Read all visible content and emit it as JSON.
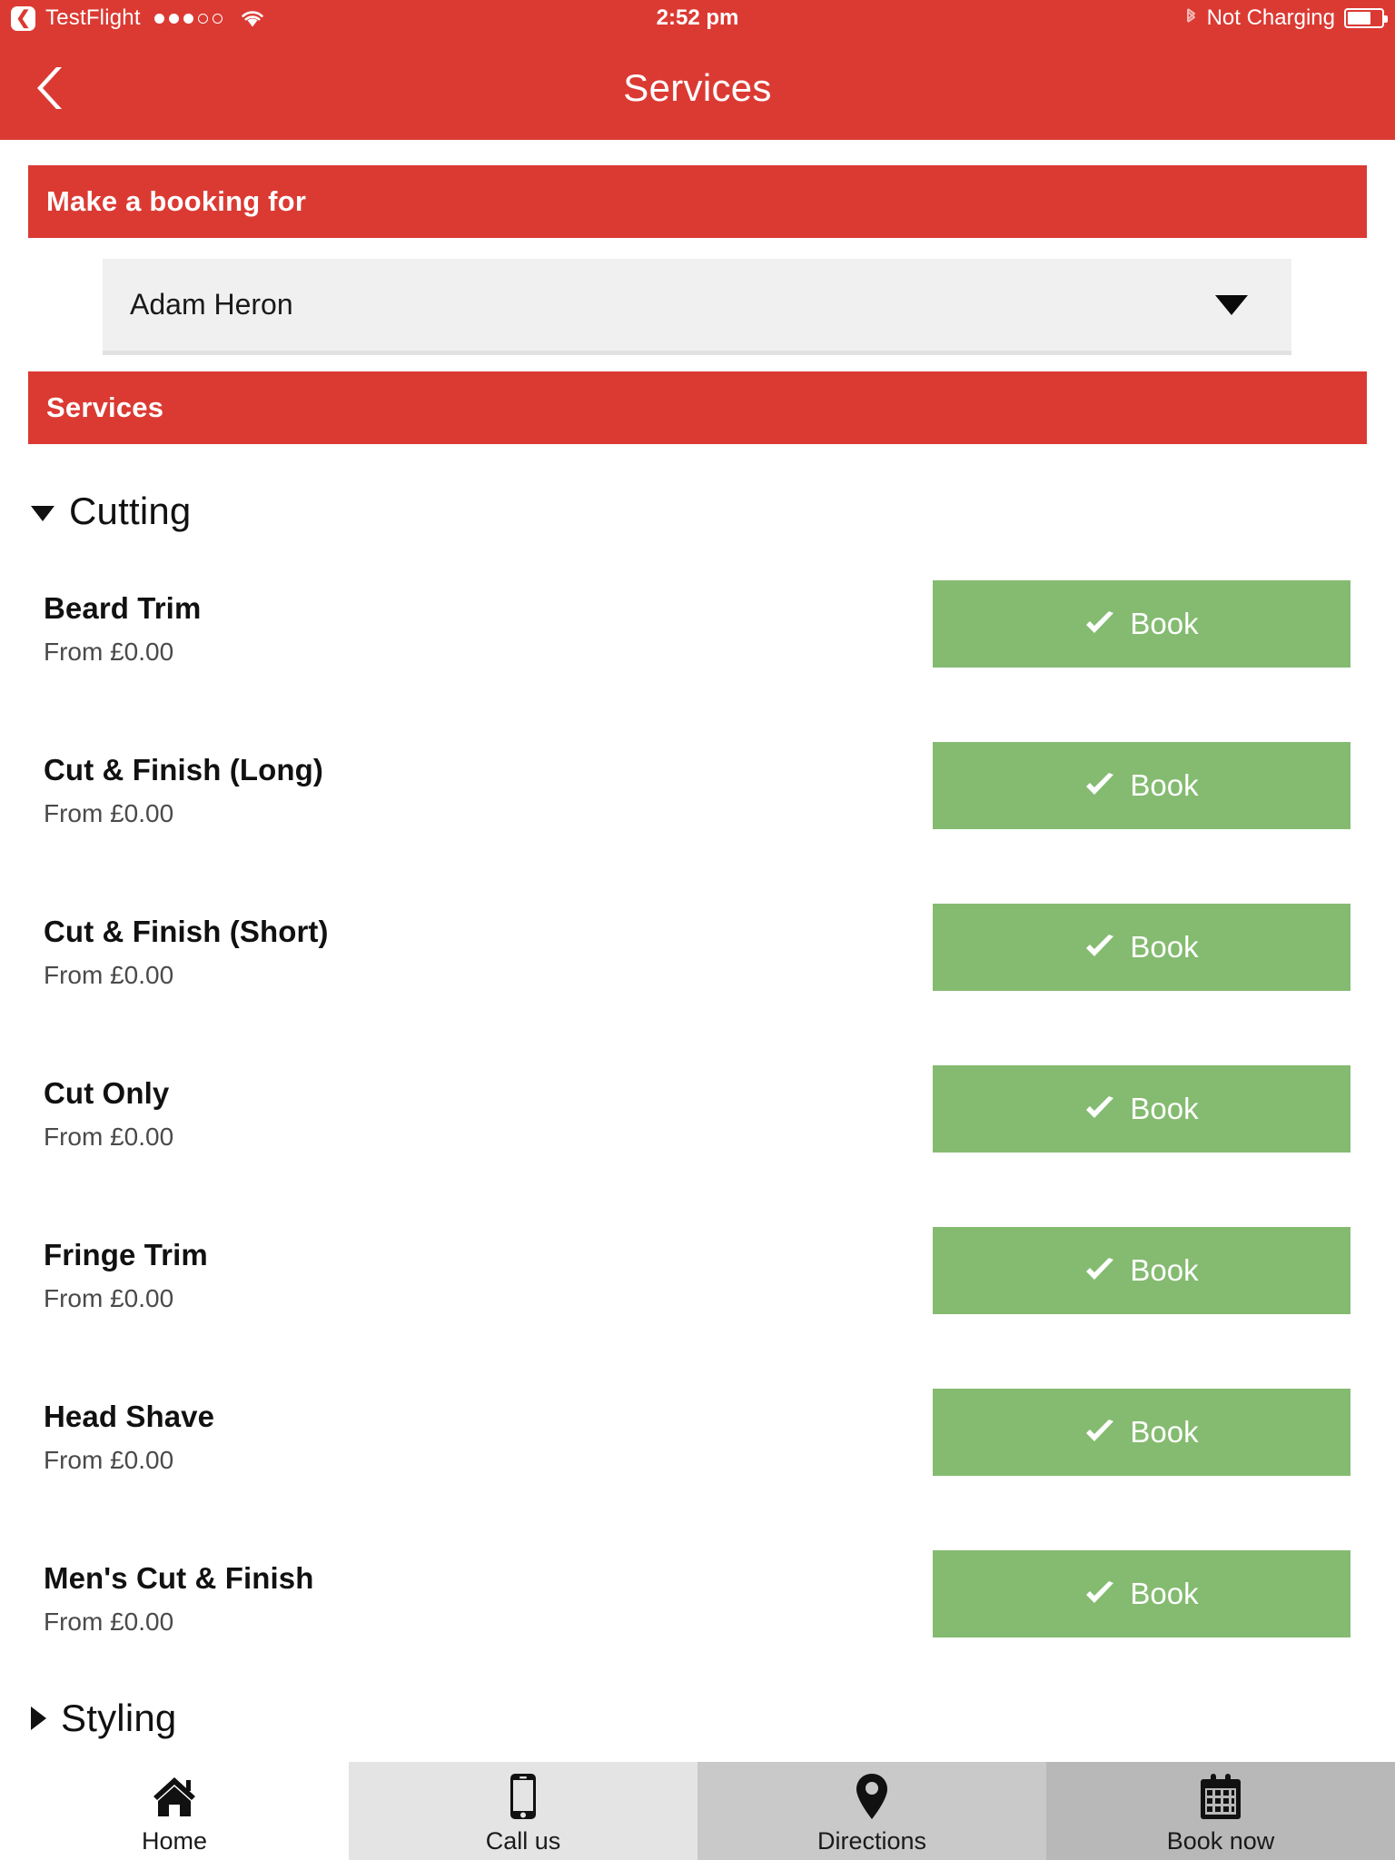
{
  "status_bar": {
    "carrier": "TestFlight",
    "signal_dots_total": 5,
    "signal_dots_filled": 3,
    "wifi_icon": "wifi-icon",
    "time": "2:52 pm",
    "bluetooth_icon": "bluetooth-icon",
    "battery_text": "Not Charging",
    "battery_icon": "battery-icon",
    "battery_level_percent": 70
  },
  "nav": {
    "back_icon": "chevron-left-icon",
    "title": "Services"
  },
  "booking": {
    "banner_title": "Make a booking for",
    "picker_value": "Adam Heron",
    "picker_arrow_icon": "chevron-down-icon"
  },
  "services": {
    "banner_title": "Services",
    "categories": [
      {
        "label": "Cutting",
        "expanded": true,
        "caret_icon": "caret-down-icon",
        "items": [
          {
            "name": "Beard Trim",
            "price": "From £0.00",
            "book_label": "Book",
            "book_icon": "check-icon"
          },
          {
            "name": "Cut & Finish (Long)",
            "price": "From £0.00",
            "book_label": "Book",
            "book_icon": "check-icon"
          },
          {
            "name": "Cut & Finish (Short)",
            "price": "From £0.00",
            "book_label": "Book",
            "book_icon": "check-icon"
          },
          {
            "name": "Cut Only",
            "price": "From £0.00",
            "book_label": "Book",
            "book_icon": "check-icon"
          },
          {
            "name": "Fringe Trim",
            "price": "From £0.00",
            "book_label": "Book",
            "book_icon": "check-icon"
          },
          {
            "name": "Head Shave",
            "price": "From £0.00",
            "book_label": "Book",
            "book_icon": "check-icon"
          },
          {
            "name": "Men's Cut & Finish",
            "price": "From £0.00",
            "book_label": "Book",
            "book_icon": "check-icon"
          }
        ]
      },
      {
        "label": "Styling",
        "expanded": false,
        "caret_icon": "caret-right-icon",
        "items": []
      }
    ]
  },
  "tab_bar": {
    "tabs": [
      {
        "label": "Home",
        "icon": "home-icon"
      },
      {
        "label": "Call us",
        "icon": "phone-icon"
      },
      {
        "label": "Directions",
        "icon": "map-pin-icon"
      },
      {
        "label": "Book now",
        "icon": "calendar-icon"
      }
    ]
  },
  "colors": {
    "brand_red": "#db3a33",
    "book_green": "#84bb70",
    "picker_bg": "#f0f0f0",
    "page_bg": "#ffffff"
  }
}
